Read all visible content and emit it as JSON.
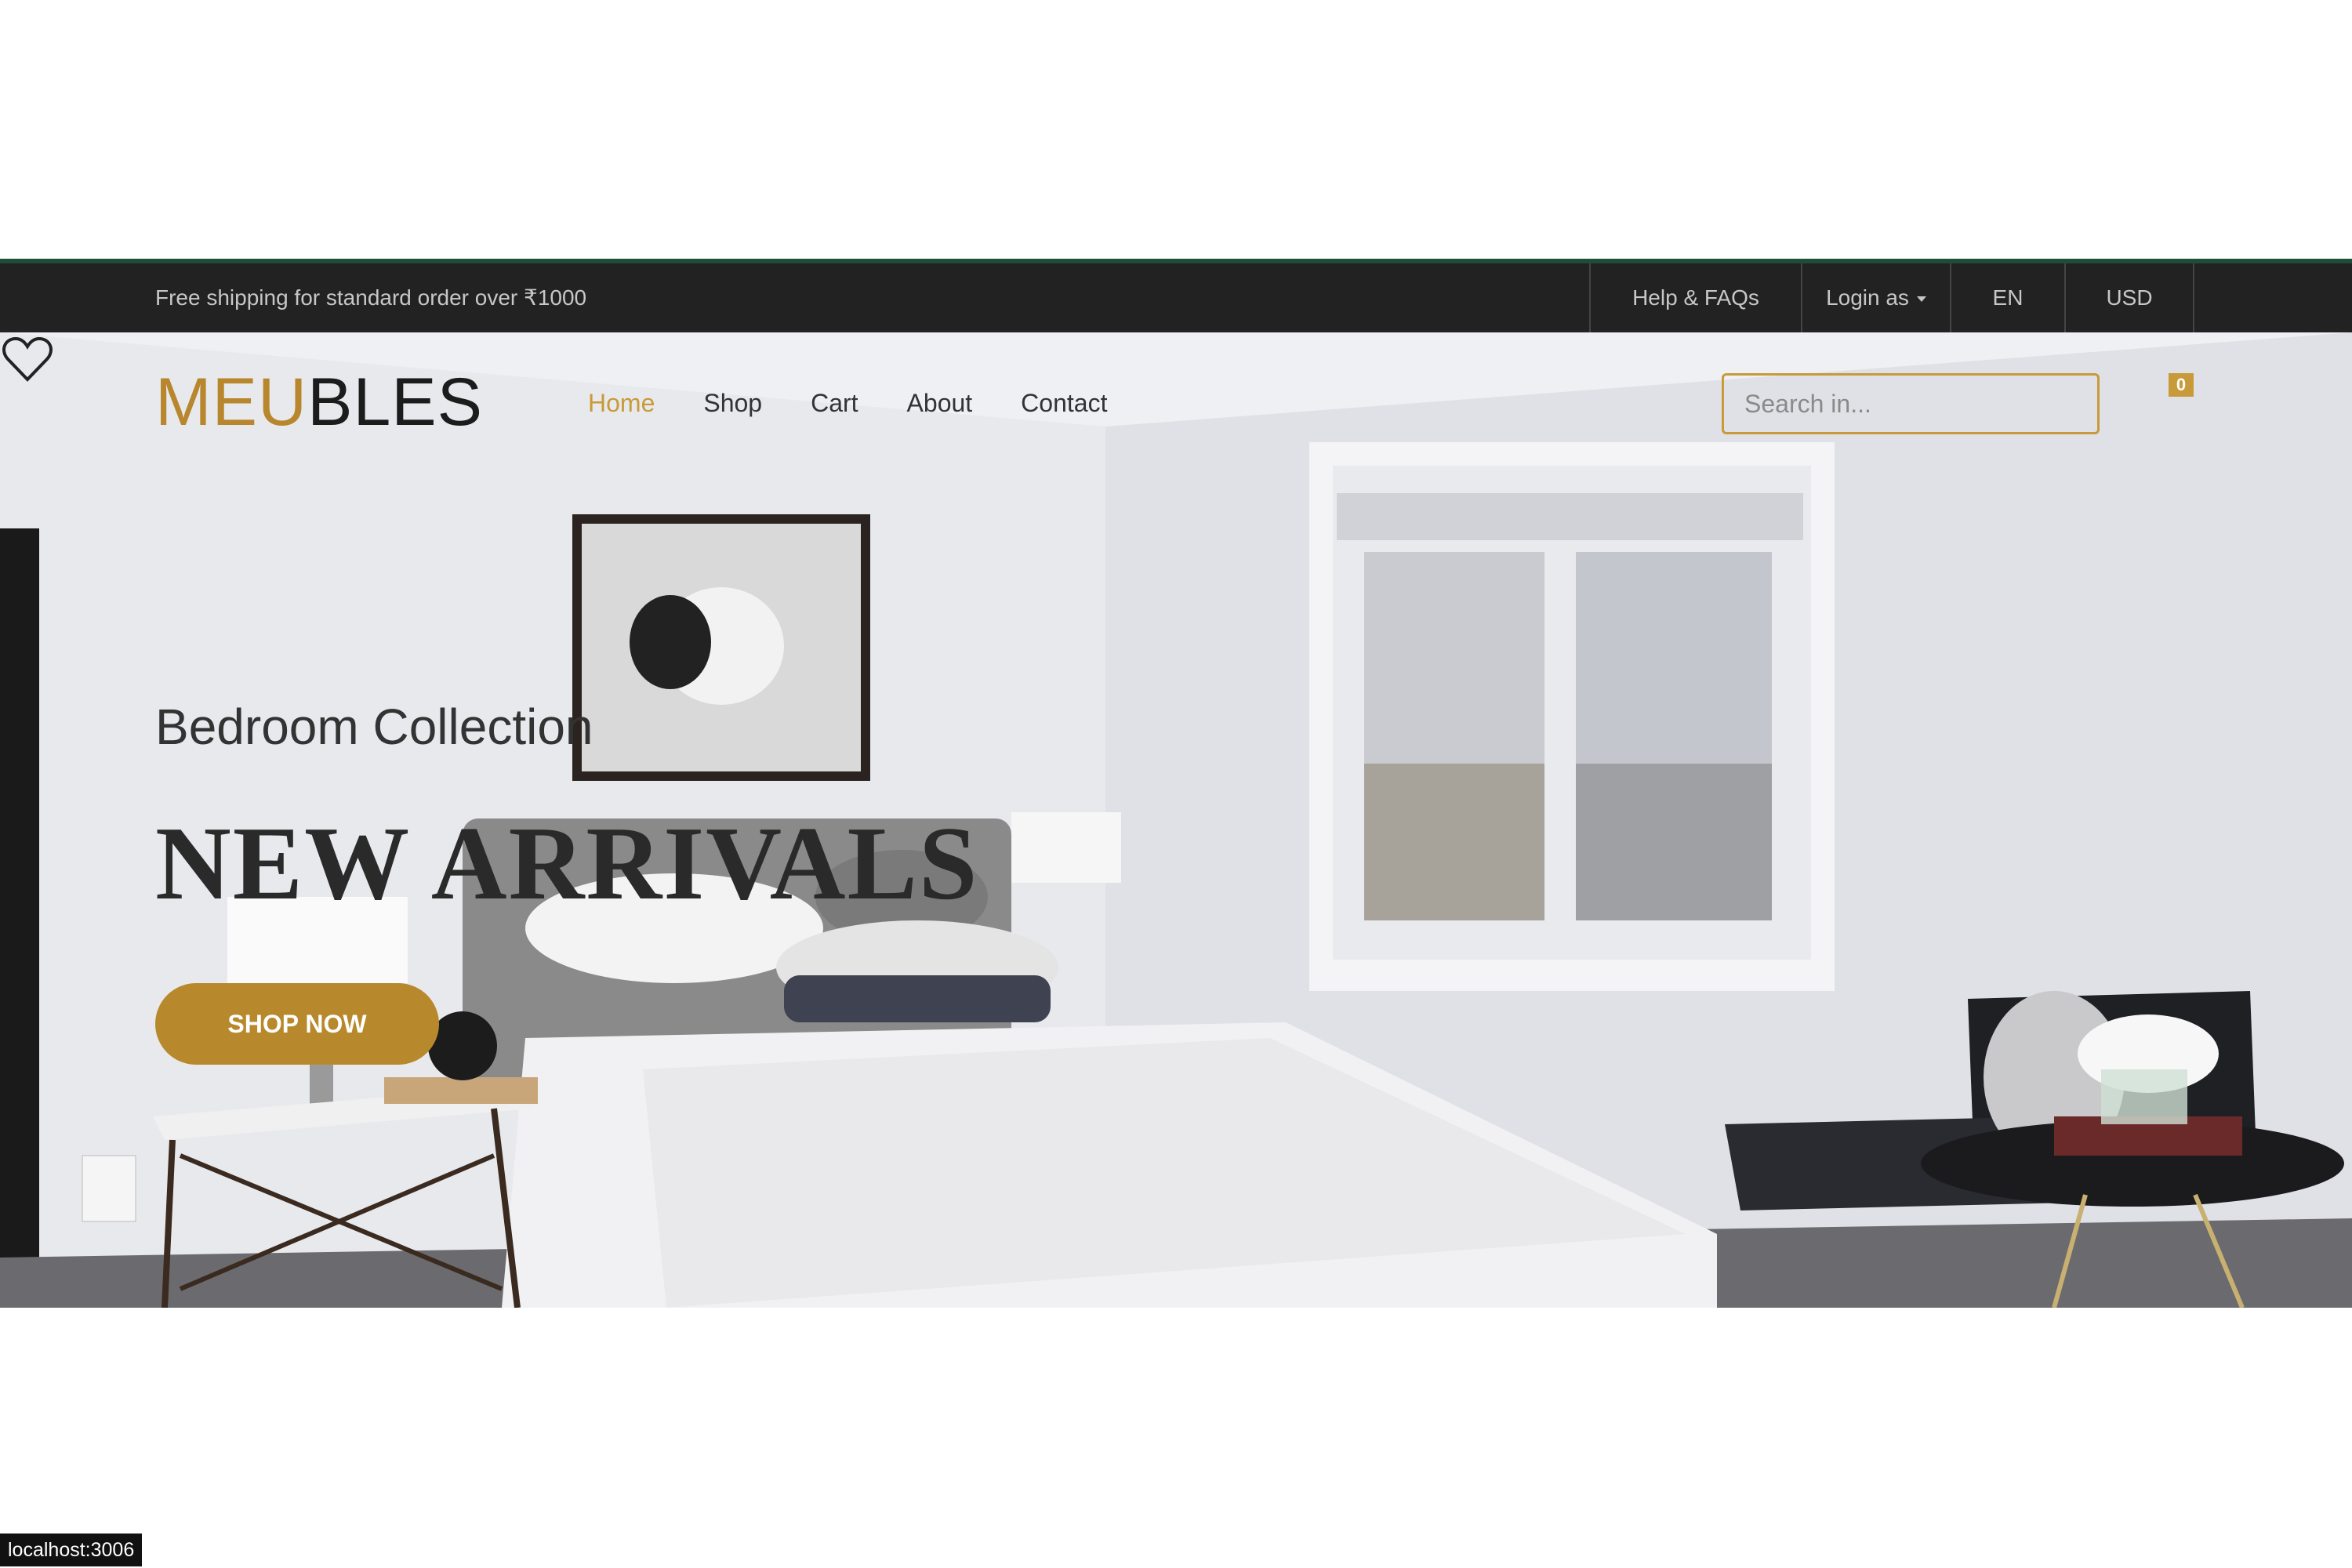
{
  "topbar": {
    "shipping_text": "Free shipping for standard order over ₹1000",
    "help": "Help & FAQs",
    "login": "Login as",
    "language": "EN",
    "currency": "USD"
  },
  "header": {
    "logo_accent": "MEU",
    "logo_rest": "BLES",
    "nav": [
      "Home",
      "Shop",
      "Cart",
      "About",
      "Contact"
    ],
    "active_nav": "Home",
    "search_placeholder": "Search in...",
    "wishlist_count": "0"
  },
  "hero": {
    "subtitle": "Bedroom Collection",
    "title": "NEW ARRIVALS",
    "button": "SHOP NOW"
  },
  "status": {
    "url": "localhost:3006"
  },
  "colors": {
    "accent": "#c89a3a",
    "topbar": "#222222",
    "button": "#b8892c"
  },
  "icons": [
    "heart-icon",
    "caret-down-icon"
  ]
}
